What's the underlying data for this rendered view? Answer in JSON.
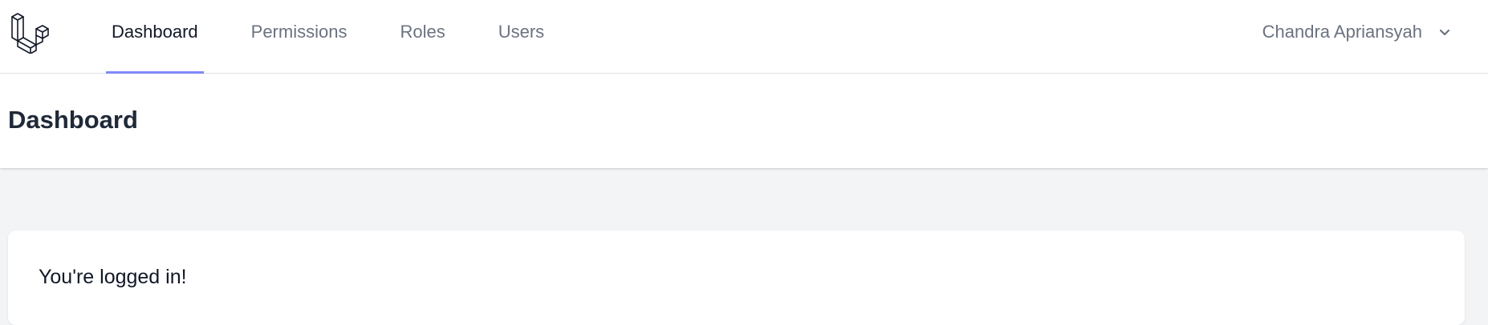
{
  "nav": {
    "items": [
      {
        "label": "Dashboard",
        "active": true
      },
      {
        "label": "Permissions",
        "active": false
      },
      {
        "label": "Roles",
        "active": false
      },
      {
        "label": "Users",
        "active": false
      }
    ],
    "user_name": "Chandra Apriansyah",
    "logo_icon": "laravel-logo-icon",
    "dropdown_icon": "chevron-down-icon"
  },
  "header": {
    "title": "Dashboard"
  },
  "content": {
    "message": "You're logged in!"
  },
  "colors": {
    "active_underline": "#818cf8",
    "page_background": "#f3f4f6",
    "inactive_text": "#6b7280"
  }
}
